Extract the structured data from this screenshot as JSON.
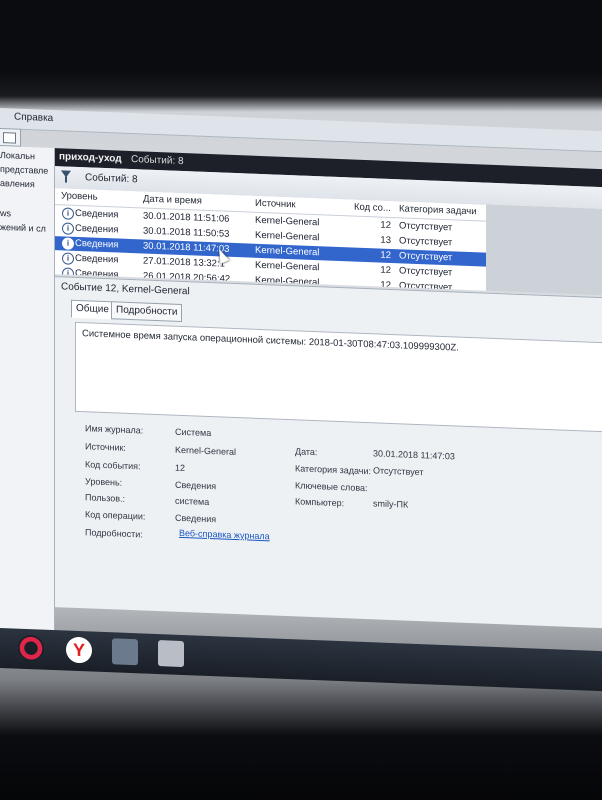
{
  "menubar": {
    "item": "Справка"
  },
  "left_tree": [
    "Локальн",
    "представле",
    "авления",
    "ws",
    "жений и сл"
  ],
  "header": {
    "title": "приход-уход",
    "count": "Событий: 8"
  },
  "filter": {
    "label": "Событий: 8"
  },
  "columns": [
    "Уровень",
    "Дата и время",
    "Источник",
    "Код со...",
    "Категория задачи"
  ],
  "rows": [
    {
      "level": "Сведения",
      "datetime": "30.01.2018 11:51:06",
      "source": "Kernel-General",
      "code": "12",
      "category": "Отсутствует"
    },
    {
      "level": "Сведения",
      "datetime": "30.01.2018 11:50:53",
      "source": "Kernel-General",
      "code": "13",
      "category": "Отсутствует"
    },
    {
      "level": "Сведения",
      "datetime": "30.01.2018 11:47:03",
      "source": "Kernel-General",
      "code": "12",
      "category": "Отсутствует"
    },
    {
      "level": "Сведения",
      "datetime": "27.01.2018 13:32:1",
      "source": "Kernel-General",
      "code": "12",
      "category": "Отсутствует"
    },
    {
      "level": "Сведения",
      "datetime": "26.01.2018 20:56:42",
      "source": "Kernel-General",
      "code": "12",
      "category": "Отсутствует"
    }
  ],
  "selected_row": 2,
  "detail": {
    "title": "Событие 12, Kernel-General",
    "tabs": [
      "Общие",
      "Подробности"
    ],
    "message": "Системное время запуска операционной системы: 2018-01-30T08:47:03.109999300Z.",
    "fields": {
      "log_label": "Имя журнала:",
      "log": "Система",
      "source_label": "Источник:",
      "source": "Kernel-General",
      "date_label": "Дата:",
      "date": "30.01.2018 11:47:03",
      "code_label": "Код события:",
      "code": "12",
      "category_label": "Категория задачи:",
      "category": "Отсутствует",
      "level_label": "Уровень:",
      "level": "Сведения",
      "keywords_label": "Ключевые слова:",
      "user_label": "Пользов.:",
      "user": "система",
      "computer_label": "Компьютер:",
      "computer": "smily-ПК",
      "opcode_label": "Код операции:",
      "opcode": "Сведения",
      "more_label": "Подробности:",
      "more_link": "Веб-справка журнала"
    }
  },
  "taskbar": {
    "icons": [
      "opera-icon",
      "yandex-browser-icon",
      "app-icon",
      "document-icon"
    ]
  },
  "colors": {
    "selection": "#3366cc",
    "header": "#1d2028",
    "link": "#1a56c2"
  }
}
